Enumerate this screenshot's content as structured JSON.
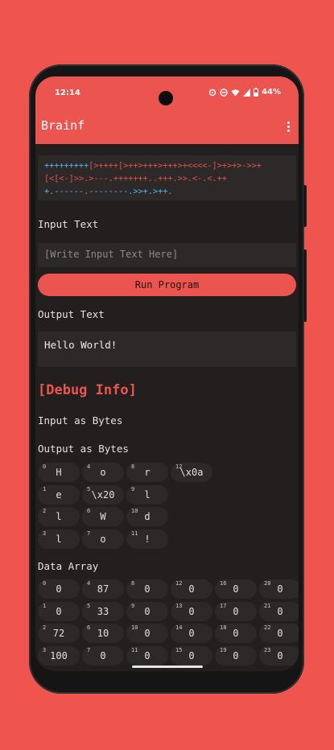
{
  "status_bar": {
    "time": "12:14",
    "battery": "44%"
  },
  "app": {
    "title": "Brainf"
  },
  "code": {
    "lines": [
      [
        [
          "+++++++++",
          "#4fb7f0"
        ],
        [
          "[>++++[>++>+++>+++>+<<<<-]>+>+>->>+",
          "#e1524d"
        ]
      ],
      [
        [
          "[<[<-]>>.>---.+++++++..+++.>>.<-.<.++",
          "#e1524d"
        ]
      ],
      [
        [
          "+.------.--------.>>+.>++.",
          "#4fb7f0"
        ]
      ]
    ]
  },
  "input": {
    "label": "Input Text",
    "placeholder": "[Write Input Text Here]"
  },
  "run_button": {
    "label": "Run Program"
  },
  "output": {
    "label": "Output Text",
    "value": "Hello World!"
  },
  "debug": {
    "heading": "[Debug Info]",
    "input_bytes_label": "Input as Bytes",
    "output_bytes_label": "Output as Bytes",
    "output_bytes": [
      {
        "index": "0",
        "value": "H"
      },
      {
        "index": "1",
        "value": "e"
      },
      {
        "index": "2",
        "value": "l"
      },
      {
        "index": "3",
        "value": "l"
      },
      {
        "index": "4",
        "value": "o"
      },
      {
        "index": "5",
        "value": "\\x20"
      },
      {
        "index": "6",
        "value": "W"
      },
      {
        "index": "7",
        "value": "o"
      },
      {
        "index": "8",
        "value": "r"
      },
      {
        "index": "9",
        "value": "l"
      },
      {
        "index": "10",
        "value": "d"
      },
      {
        "index": "11",
        "value": "!"
      },
      {
        "index": "12",
        "value": "\\x0a"
      }
    ],
    "data_array_label": "Data Array",
    "data_array": [
      {
        "index": "0",
        "value": "0"
      },
      {
        "index": "1",
        "value": "0"
      },
      {
        "index": "2",
        "value": "72"
      },
      {
        "index": "3",
        "value": "100"
      },
      {
        "index": "4",
        "value": "87"
      },
      {
        "index": "5",
        "value": "33"
      },
      {
        "index": "6",
        "value": "10"
      },
      {
        "index": "7",
        "value": "0"
      },
      {
        "index": "8",
        "value": "0"
      },
      {
        "index": "9",
        "value": "0"
      },
      {
        "index": "10",
        "value": "0"
      },
      {
        "index": "11",
        "value": "0"
      },
      {
        "index": "12",
        "value": "0"
      },
      {
        "index": "13",
        "value": "0"
      },
      {
        "index": "14",
        "value": "0"
      },
      {
        "index": "15",
        "value": "0"
      },
      {
        "index": "16",
        "value": "0"
      },
      {
        "index": "17",
        "value": "0"
      },
      {
        "index": "18",
        "value": "0"
      },
      {
        "index": "19",
        "value": "0"
      },
      {
        "index": "20",
        "value": "0"
      },
      {
        "index": "21",
        "value": "0"
      },
      {
        "index": "22",
        "value": "0"
      },
      {
        "index": "23",
        "value": "0"
      }
    ]
  },
  "colors": {
    "background": "#f0544f",
    "accent": "#ec5450",
    "surface": "#2d2929",
    "screen": "#231f1f",
    "code_blue": "#4fb7f0"
  }
}
